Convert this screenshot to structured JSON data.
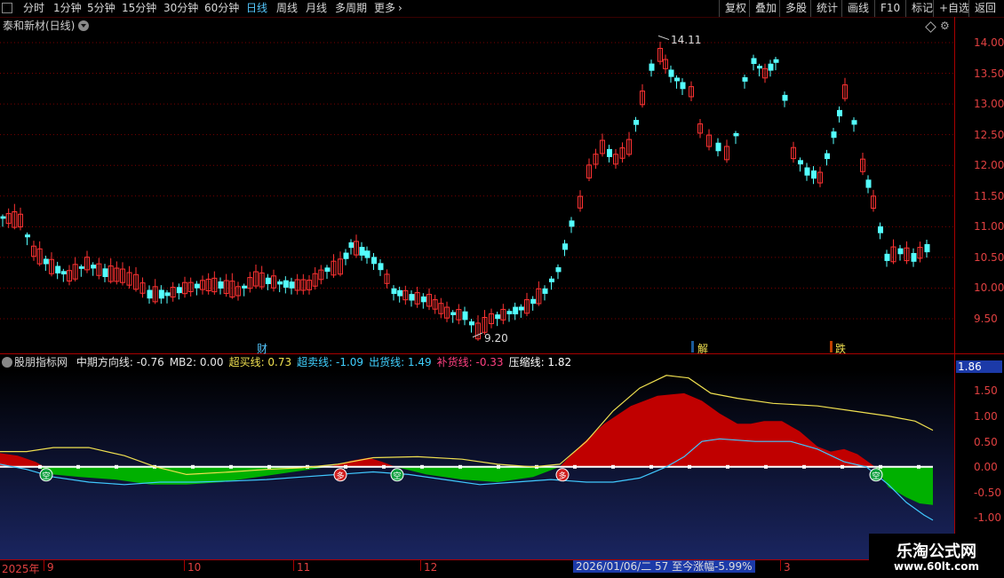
{
  "toolbar": {
    "left_items": [
      "分时",
      "1分钟",
      "5分钟",
      "15分钟",
      "30分钟",
      "60分钟",
      "日线",
      "周线",
      "月线",
      "多周期",
      "更多"
    ],
    "active": "日线",
    "right_items": [
      "复权",
      "叠加",
      "多股",
      "统计",
      "画线",
      "F10",
      "标记",
      "+自选",
      "返回"
    ]
  },
  "stock": {
    "title": "泰和新材(日线)"
  },
  "price_axis": {
    "labels": [
      "14.00",
      "13.50",
      "13.00",
      "12.50",
      "12.00",
      "11.50",
      "11.00",
      "10.50",
      "10.00",
      "9.50"
    ]
  },
  "price_annotations": {
    "high": "14.11",
    "low": "9.20",
    "marker_cai": "财",
    "marker_jie": "解",
    "marker_die": "跌"
  },
  "indicator": {
    "title": "股朋指标网",
    "legend": [
      {
        "text": "中期方向线: -0.76",
        "color": "#e8e8e8"
      },
      {
        "text": "MB2: 0.00",
        "color": "#e8e8e8"
      },
      {
        "text": "超买线: 0.73",
        "color": "#f0e050"
      },
      {
        "text": "超卖线: -1.09",
        "color": "#40d0ff"
      },
      {
        "text": "出货线: 1.49",
        "color": "#40d0ff"
      },
      {
        "text": "补货线: -0.33",
        "color": "#ff4080"
      },
      {
        "text": "压缩线: 1.82",
        "color": "#ffffff"
      }
    ],
    "current_value": "1.86",
    "axis_labels": [
      "1.50",
      "1.00",
      "0.50",
      "0.00",
      "-0.50",
      "-1.00"
    ],
    "signals": {
      "kong": "空",
      "duo": "多"
    }
  },
  "date_axis": {
    "labels": [
      "2025年",
      "9",
      "10",
      "11",
      "12",
      "3"
    ],
    "info": "2026/01/06/二 57 至今涨幅-5.99%"
  },
  "watermark": {
    "title": "乐淘公式网",
    "url": "www.60lt.com"
  },
  "chart_data": {
    "type": "candlestick",
    "price_ylim": [
      9.2,
      14.11
    ],
    "high": 14.11,
    "low": 9.2,
    "indicator_series": [
      {
        "name": "中期方向线",
        "last": -0.76
      },
      {
        "name": "MB2",
        "last": 0.0
      },
      {
        "name": "超买线",
        "last": 0.73
      },
      {
        "name": "超卖线",
        "last": -1.09
      },
      {
        "name": "出货线",
        "last": 1.49
      },
      {
        "name": "补货线",
        "last": -0.33
      },
      {
        "name": "压缩线",
        "last": 1.82
      }
    ]
  }
}
